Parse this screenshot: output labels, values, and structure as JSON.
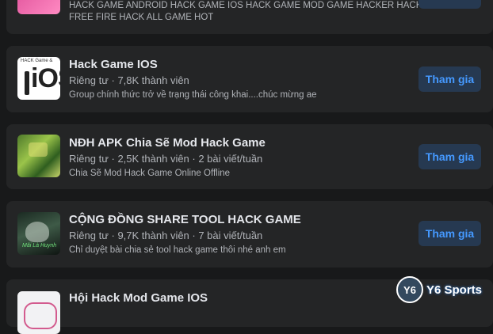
{
  "groups": [
    {
      "name": "",
      "meta": "",
      "description_lines": [
        "HACK GAME ANDROID HACK GAME IOS HACK GAME MOD GAME HACKER HACK",
        "FREE FIRE HACK ALL GAME HOT"
      ],
      "join_label": ""
    },
    {
      "name": "Hack Game IOS",
      "meta": "Riêng tư · 7,8K thành viên",
      "description": "Group chính thức trở về trạng thái công khai....chúc mừng ae",
      "join_label": "Tham gia",
      "thumb_text": "iOS",
      "thumb_caption": "HACK Game &"
    },
    {
      "name": "NĐH APK Chia Sẽ Mod Hack Game",
      "meta": "Riêng tư · 2,5K thành viên · 2 bài viết/tuần",
      "description": "Chia Sẽ Mod Hack Game Online Offline",
      "join_label": "Tham gia"
    },
    {
      "name": "CỘNG ĐỒNG SHARE TOOL HACK GAME",
      "meta": "Riêng tư · 9,7K thành viên · 7 bài viết/tuần",
      "description": "Chỉ duyệt bài chia sẻ tool hack game thôi nhé anh em",
      "join_label": "Tham gia",
      "thumb_caption": "Mãi Là Huynh"
    },
    {
      "name": "Hội Hack Mod Game IOS"
    }
  ],
  "watermark": {
    "logo_text": "Y6",
    "text": "Y6 Sports"
  },
  "colors": {
    "background": "#18191a",
    "card": "#242526",
    "join_bg": "#263951",
    "join_text": "#4599ff"
  }
}
